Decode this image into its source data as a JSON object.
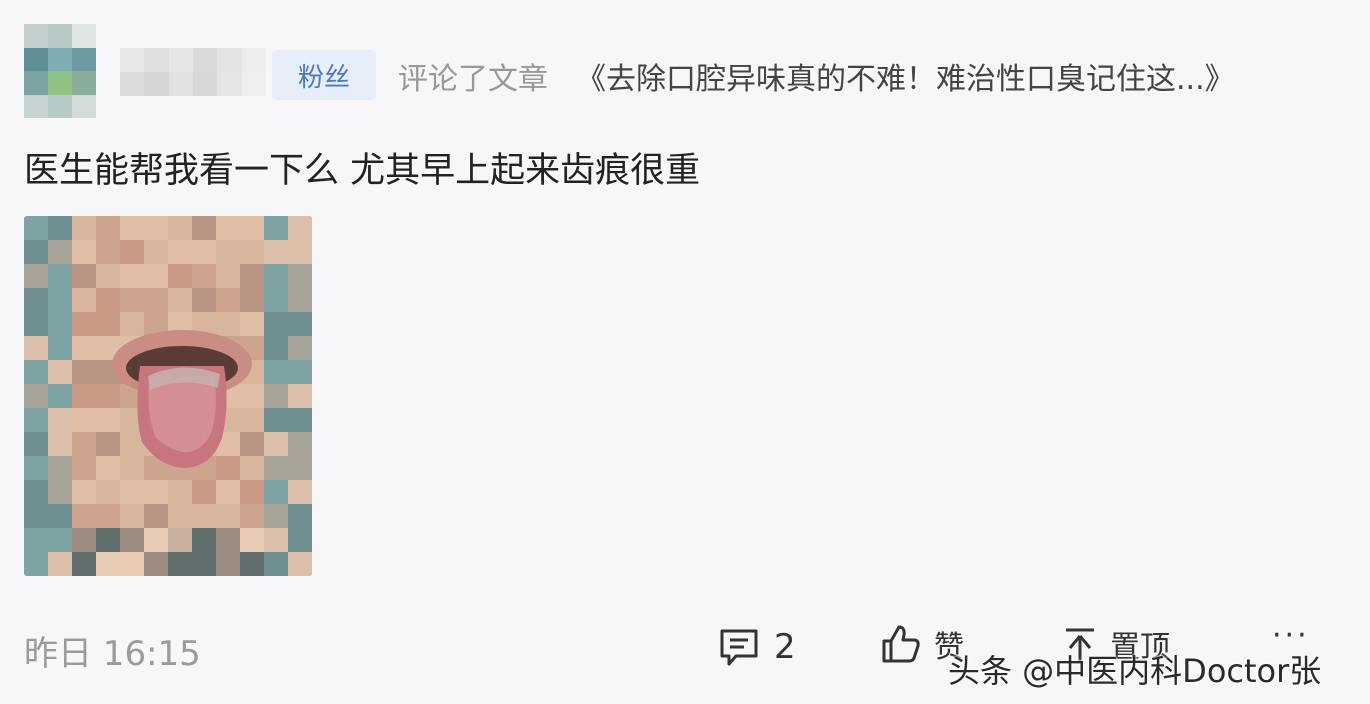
{
  "header": {
    "badge": "粉丝",
    "action": "评论了文章",
    "article_title": "《去除口腔异味真的不难！难治性口臭记住这...》"
  },
  "comment": {
    "text": "医生能帮我看一下么 尤其早上起来齿痕很重"
  },
  "footer": {
    "time": "昨日 16:15",
    "reply_count": "2",
    "like_label": "赞",
    "pin_label": "置顶",
    "more_label": "···"
  },
  "watermark": "头条 @中医内科Doctor张",
  "colors": {
    "background": "#f7f7f9",
    "badge_bg": "#e8eef8",
    "badge_text": "#4a78c2",
    "muted_text": "#999999"
  }
}
